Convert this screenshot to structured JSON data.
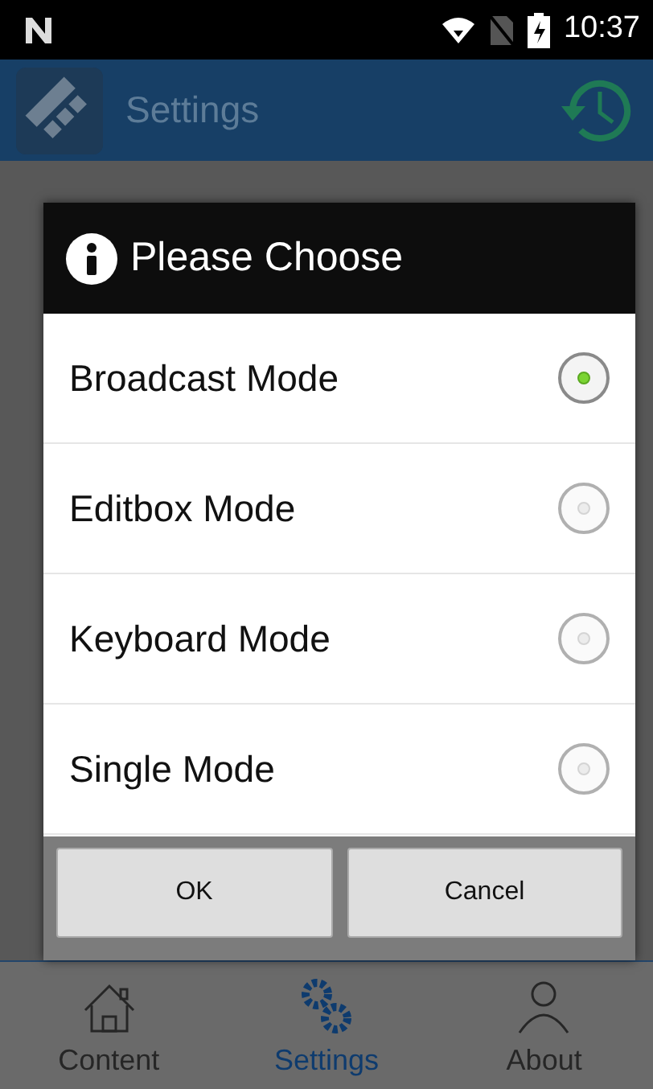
{
  "status_bar": {
    "time": "10:37"
  },
  "app_bar": {
    "title": "Settings"
  },
  "dialog": {
    "title": "Please Choose",
    "options": [
      {
        "label": "Broadcast Mode",
        "selected": true
      },
      {
        "label": "Editbox Mode",
        "selected": false
      },
      {
        "label": "Keyboard Mode",
        "selected": false
      },
      {
        "label": "Single Mode",
        "selected": false
      }
    ],
    "buttons": [
      "OK",
      "Cancel"
    ]
  },
  "bottom_nav": [
    {
      "label": "Content",
      "kind": "home",
      "selected": false
    },
    {
      "label": "Settings",
      "kind": "gears",
      "selected": true
    },
    {
      "label": "About",
      "kind": "person",
      "selected": false
    }
  ]
}
